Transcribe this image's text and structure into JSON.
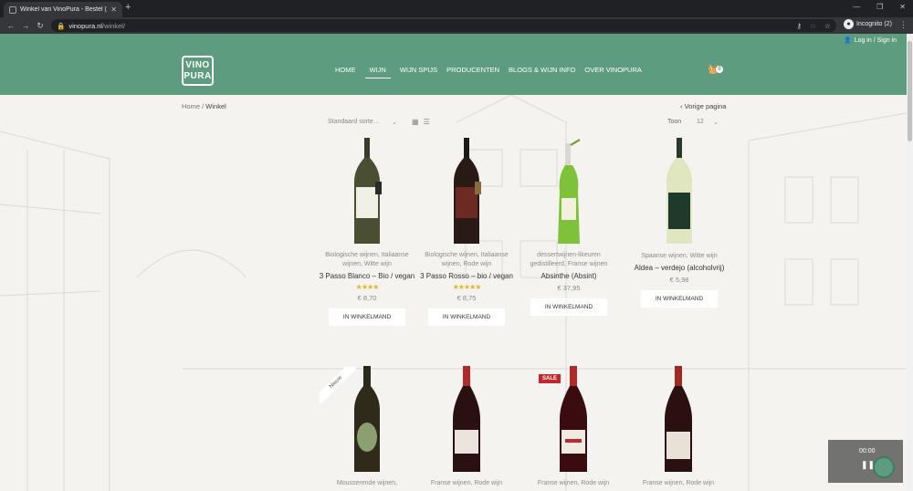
{
  "browser": {
    "tab_title": "Winkel van VinoPura - Bestel (H…",
    "url_host": "vinopura.nl",
    "url_path": "/winkel/",
    "profile_label": "Incognito (2)"
  },
  "header": {
    "login_label": "Log in / Sign in",
    "logo_line1": "VINO",
    "logo_line2": "PURA",
    "nav": [
      "HOME",
      "WIJN",
      "WIJN SPIJS",
      "PRODUCENTEN",
      "BLOGS & WIJN INFO",
      "OVER VINOPURA"
    ],
    "active_nav": "WIJN",
    "cart_count": "0"
  },
  "toolbar": {
    "breadcrumb_home": "Home",
    "breadcrumb_sep": " / ",
    "breadcrumb_current": "Winkel",
    "previous_page": "Vorige pagina",
    "sort_label": "Standaard sorte…",
    "show_label": "Toon",
    "per_page": "12"
  },
  "products": [
    {
      "category": "Biologische wijnen, Italiaanse wijnen, Witte wijn",
      "name": "3 Passo Blanco – Bio / vegan",
      "stars": "★★★★",
      "price": "€ 8,70",
      "button": "IN WINKELMAND"
    },
    {
      "category": "Biologische wijnen, Italiaanse wijnen, Rode wijn",
      "name": "3 Passo Rosso – bio / vegan",
      "stars": "★★★★★",
      "price": "€ 8,75",
      "button": "IN WINKELMAND"
    },
    {
      "category": "dessertwijnen-likeuren gedistilleerd, Franse wijnen",
      "name": "Absinthe (Absint)",
      "stars": "",
      "price": "€ 37,95",
      "button": "IN WINKELMAND"
    },
    {
      "category": "Spaanse wijnen, Witte wijn",
      "name": "Aldea – verdejo (alcoholvrij)",
      "stars": "",
      "price": "€ 5,98",
      "button": "IN WINKELMAND"
    }
  ],
  "products_row2": [
    {
      "category": "Mousserende wijnen,",
      "badge": "Nieuw"
    },
    {
      "category": "Franse wijnen, Rode wijn"
    },
    {
      "category": "Franse wijnen, Rode wijn",
      "badge": "SALE"
    },
    {
      "category": "Franse wijnen, Rode wijn"
    }
  ],
  "video": {
    "time": "00:00"
  }
}
